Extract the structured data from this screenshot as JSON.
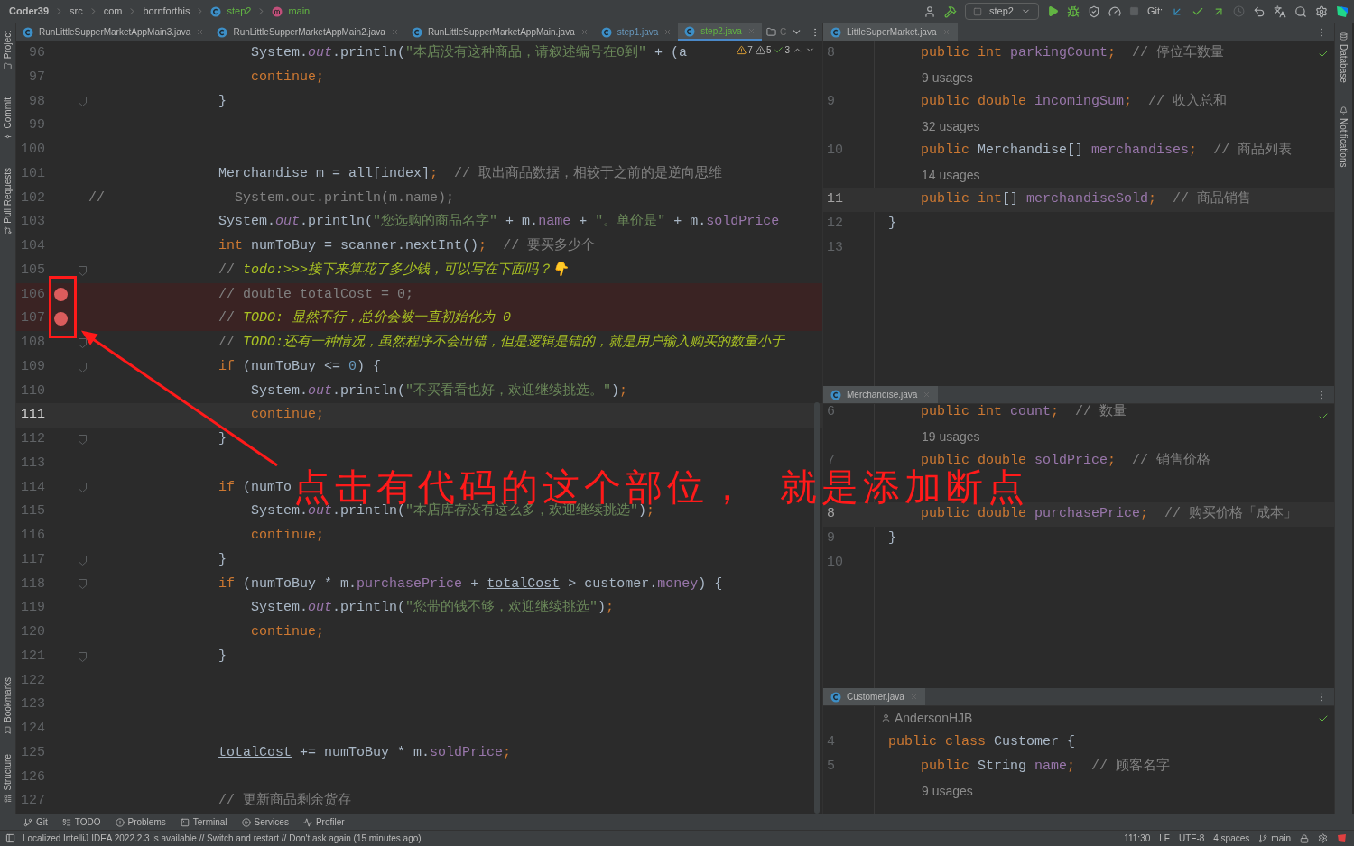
{
  "breadcrumbs": [
    {
      "text": "Coder39",
      "kind": "project"
    },
    {
      "text": "src",
      "kind": "folder"
    },
    {
      "text": "com",
      "kind": "folder"
    },
    {
      "text": "bornforthis",
      "kind": "folder"
    },
    {
      "text": "step2",
      "kind": "class"
    },
    {
      "text": "main",
      "kind": "method"
    }
  ],
  "toolbar": {
    "run_config": "step2",
    "git_label": "Git:"
  },
  "left_tools_top": [
    "Project",
    "Commit",
    "Pull Requests"
  ],
  "left_tools_bottom": [
    "Bookmarks",
    "Structure"
  ],
  "right_tools": [
    "Database",
    "Notifications"
  ],
  "editor": {
    "tabs": [
      {
        "label": "RunLittleSupperMarketAppMain3.java",
        "selected": false,
        "color": "#bbbbbb"
      },
      {
        "label": "RunLittleSupperMarketAppMain2.java",
        "selected": false,
        "color": "#bbbbbb"
      },
      {
        "label": "RunLittleSupperMarketAppMain.java",
        "selected": false,
        "color": "#bbbbbb"
      },
      {
        "label": "step1.java",
        "selected": false,
        "color": "#6897bb"
      },
      {
        "label": "step2.java",
        "selected": true,
        "color": "#62b543"
      }
    ],
    "overflow_tab": "C",
    "inspections": [
      {
        "kind": "error",
        "count": "7"
      },
      {
        "kind": "warning",
        "count": "5"
      },
      {
        "kind": "ok",
        "count": "3"
      }
    ],
    "lines": [
      {
        "number": "96",
        "current": false,
        "breakpoint": false,
        "fold": false,
        "tokens": [
          {
            "kind": "plain",
            "text": "                    System."
          },
          {
            "kind": "static",
            "text": "out"
          },
          {
            "kind": "plain",
            "text": ".println("
          },
          {
            "kind": "string",
            "text": "\"本店没有这种商品，请叙述编号在0到\""
          },
          {
            "kind": "plain",
            "text": " + (a"
          }
        ]
      },
      {
        "number": "97",
        "current": false,
        "breakpoint": false,
        "fold": false,
        "tokens": [
          {
            "kind": "keyword",
            "text": "                    continue;"
          }
        ]
      },
      {
        "number": "98",
        "current": false,
        "breakpoint": false,
        "fold": true,
        "tokens": [
          {
            "kind": "plain",
            "text": "                }"
          }
        ]
      },
      {
        "number": "99",
        "current": false,
        "breakpoint": false,
        "fold": false
      },
      {
        "number": "100",
        "current": false,
        "breakpoint": false,
        "fold": false
      },
      {
        "number": "101",
        "current": false,
        "breakpoint": false,
        "fold": false,
        "tokens": [
          {
            "kind": "plain",
            "text": "                Merchandise m = all[index]"
          },
          {
            "kind": "keyword",
            "text": ";"
          },
          {
            "kind": "comment",
            "text": "  // 取出商品数据，相较于之前的是逆向思维"
          }
        ]
      },
      {
        "number": "102",
        "current": false,
        "breakpoint": false,
        "fold": false,
        "tokens": [
          {
            "kind": "comment",
            "text": "//                System.out.println(m.name);"
          }
        ]
      },
      {
        "number": "103",
        "current": false,
        "breakpoint": false,
        "fold": false,
        "tokens": [
          {
            "kind": "plain",
            "text": "                System."
          },
          {
            "kind": "static",
            "text": "out"
          },
          {
            "kind": "plain",
            "text": ".println("
          },
          {
            "kind": "string",
            "text": "\"您选购的商品名字\""
          },
          {
            "kind": "plain",
            "text": " + m."
          },
          {
            "kind": "field",
            "text": "name"
          },
          {
            "kind": "plain",
            "text": " + "
          },
          {
            "kind": "string",
            "text": "\"。单价是\""
          },
          {
            "kind": "plain",
            "text": " + m."
          },
          {
            "kind": "field",
            "text": "soldPrice"
          }
        ]
      },
      {
        "number": "104",
        "current": false,
        "breakpoint": false,
        "fold": false,
        "tokens": [
          {
            "kind": "keyword",
            "text": "                int"
          },
          {
            "kind": "plain",
            "text": " numToBuy = scanner.nextInt()"
          },
          {
            "kind": "keyword",
            "text": ";"
          },
          {
            "kind": "comment",
            "text": "  // 要买多少个"
          }
        ]
      },
      {
        "number": "105",
        "current": false,
        "breakpoint": false,
        "fold": true,
        "tokens": [
          {
            "kind": "comment",
            "text": "                // "
          },
          {
            "kind": "todo",
            "text": "todo:>>>接下来算花了多少钱，可以写在下面吗？👇"
          }
        ]
      },
      {
        "number": "106",
        "current": false,
        "breakpoint": true,
        "fold": false,
        "tokens": [
          {
            "kind": "comment",
            "text": "                // double totalCost = 0;"
          }
        ]
      },
      {
        "number": "107",
        "current": false,
        "breakpoint": true,
        "fold": false,
        "tokens": [
          {
            "kind": "comment",
            "text": "                // "
          },
          {
            "kind": "todo",
            "text": "TODO: 显然不行，总价会被一直初始化为 0"
          }
        ]
      },
      {
        "number": "108",
        "current": false,
        "breakpoint": false,
        "fold": true,
        "tokens": [
          {
            "kind": "comment",
            "text": "                // "
          },
          {
            "kind": "todo",
            "text": "TODO:还有一种情况，虽然程序不会出错，但是逻辑是错的，就是用户输入购买的数量小于"
          }
        ]
      },
      {
        "number": "109",
        "current": false,
        "breakpoint": false,
        "fold": true,
        "tokens": [
          {
            "kind": "keyword",
            "text": "                if"
          },
          {
            "kind": "plain",
            "text": " (numToBuy <= "
          },
          {
            "kind": "number",
            "text": "0"
          },
          {
            "kind": "plain",
            "text": ") {"
          }
        ]
      },
      {
        "number": "110",
        "current": false,
        "breakpoint": false,
        "fold": false,
        "tokens": [
          {
            "kind": "plain",
            "text": "                    System."
          },
          {
            "kind": "static",
            "text": "out"
          },
          {
            "kind": "plain",
            "text": ".println("
          },
          {
            "kind": "string",
            "text": "\"不买看看也好，欢迎继续挑选。\""
          },
          {
            "kind": "plain",
            "text": ")"
          },
          {
            "kind": "keyword",
            "text": ";"
          }
        ]
      },
      {
        "number": "111",
        "current": true,
        "breakpoint": false,
        "fold": false,
        "tokens": [
          {
            "kind": "keyword",
            "text": "                    continue;"
          }
        ]
      },
      {
        "number": "112",
        "current": false,
        "breakpoint": false,
        "fold": true,
        "tokens": [
          {
            "kind": "plain",
            "text": "                }"
          }
        ]
      },
      {
        "number": "113",
        "current": false,
        "breakpoint": false,
        "fold": false
      },
      {
        "number": "114",
        "current": false,
        "breakpoint": false,
        "fold": true,
        "tokens": [
          {
            "kind": "keyword",
            "text": "                if"
          },
          {
            "kind": "plain",
            "text": " (numTo"
          }
        ]
      },
      {
        "number": "115",
        "current": false,
        "breakpoint": false,
        "fold": false,
        "tokens": [
          {
            "kind": "plain",
            "text": "                    System."
          },
          {
            "kind": "static",
            "text": "out"
          },
          {
            "kind": "plain",
            "text": ".println("
          },
          {
            "kind": "string",
            "text": "\"本店库存没有这么多，欢迎继续挑选\""
          },
          {
            "kind": "plain",
            "text": ")"
          },
          {
            "kind": "keyword",
            "text": ";"
          }
        ]
      },
      {
        "number": "116",
        "current": false,
        "breakpoint": false,
        "fold": false,
        "tokens": [
          {
            "kind": "keyword",
            "text": "                    continue;"
          }
        ]
      },
      {
        "number": "117",
        "current": false,
        "breakpoint": false,
        "fold": true,
        "tokens": [
          {
            "kind": "plain",
            "text": "                }"
          }
        ]
      },
      {
        "number": "118",
        "current": false,
        "breakpoint": false,
        "fold": true,
        "tokens": [
          {
            "kind": "keyword",
            "text": "                if"
          },
          {
            "kind": "plain",
            "text": " (numToBuy * m."
          },
          {
            "kind": "field",
            "text": "purchasePrice"
          },
          {
            "kind": "plain",
            "text": " + "
          },
          {
            "kind": "underlined",
            "text": "totalCost"
          },
          {
            "kind": "plain",
            "text": " > customer."
          },
          {
            "kind": "field",
            "text": "money"
          },
          {
            "kind": "plain",
            "text": ") {"
          }
        ]
      },
      {
        "number": "119",
        "current": false,
        "breakpoint": false,
        "fold": false,
        "tokens": [
          {
            "kind": "plain",
            "text": "                    System."
          },
          {
            "kind": "static",
            "text": "out"
          },
          {
            "kind": "plain",
            "text": ".println("
          },
          {
            "kind": "string",
            "text": "\"您带的钱不够，欢迎继续挑选\""
          },
          {
            "kind": "plain",
            "text": ")"
          },
          {
            "kind": "keyword",
            "text": ";"
          }
        ]
      },
      {
        "number": "120",
        "current": false,
        "breakpoint": false,
        "fold": false,
        "tokens": [
          {
            "kind": "keyword",
            "text": "                    continue;"
          }
        ]
      },
      {
        "number": "121",
        "current": false,
        "breakpoint": false,
        "fold": true,
        "tokens": [
          {
            "kind": "plain",
            "text": "                }"
          }
        ]
      },
      {
        "number": "122",
        "current": false,
        "breakpoint": false,
        "fold": false
      },
      {
        "number": "123",
        "current": false,
        "breakpoint": false,
        "fold": false
      },
      {
        "number": "124",
        "current": false,
        "breakpoint": false,
        "fold": false
      },
      {
        "number": "125",
        "current": false,
        "breakpoint": false,
        "fold": false,
        "tokens": [
          {
            "kind": "underlined",
            "text": "                totalCost"
          },
          {
            "kind": "plain",
            "text": " += numToBuy * m."
          },
          {
            "kind": "field",
            "text": "soldPrice"
          },
          {
            "kind": "keyword",
            "text": ";"
          }
        ]
      },
      {
        "number": "126",
        "current": false,
        "breakpoint": false,
        "fold": false
      },
      {
        "number": "127",
        "current": false,
        "breakpoint": false,
        "fold": false,
        "tokens": [
          {
            "kind": "comment",
            "text": "                // 更新商品剩余货存"
          }
        ]
      }
    ]
  },
  "split_panes": [
    {
      "file": "LittleSuperMarket.java",
      "lines": [
        {
          "kind": "code",
          "number": "8",
          "current": false,
          "tokens": [
            {
              "kind": "keyword",
              "text": "    public int "
            },
            {
              "kind": "field",
              "text": "parkingCount"
            },
            {
              "kind": "keyword",
              "text": ";"
            },
            {
              "kind": "comment",
              "text": "  // 停位车数量"
            }
          ]
        },
        {
          "kind": "hint",
          "text": "9 usages"
        },
        {
          "kind": "code",
          "number": "9",
          "current": false,
          "tokens": [
            {
              "kind": "keyword",
              "text": "    public double "
            },
            {
              "kind": "field",
              "text": "incomingSum"
            },
            {
              "kind": "keyword",
              "text": ";"
            },
            {
              "kind": "comment",
              "text": "  // 收入总和"
            }
          ]
        },
        {
          "kind": "hint",
          "text": "32 usages"
        },
        {
          "kind": "code",
          "number": "10",
          "current": false,
          "tokens": [
            {
              "kind": "keyword",
              "text": "    public "
            },
            {
              "kind": "plain",
              "text": "Merchandise[] "
            },
            {
              "kind": "field",
              "text": "merchandises"
            },
            {
              "kind": "keyword",
              "text": ";"
            },
            {
              "kind": "comment",
              "text": "  // 商品列表"
            }
          ]
        },
        {
          "kind": "hint",
          "text": "14 usages"
        },
        {
          "kind": "code",
          "number": "11",
          "current": true,
          "tokens": [
            {
              "kind": "keyword",
              "text": "    public int"
            },
            {
              "kind": "plain",
              "text": "[] "
            },
            {
              "kind": "field",
              "text": "merchandiseSold"
            },
            {
              "kind": "keyword",
              "text": ";"
            },
            {
              "kind": "comment",
              "text": "  // 商品销售"
            }
          ]
        },
        {
          "kind": "code",
          "number": "12",
          "current": false,
          "tokens": [
            {
              "kind": "plain",
              "text": "}"
            }
          ]
        },
        {
          "kind": "code",
          "number": "13",
          "current": false
        }
      ]
    },
    {
      "file": "Merchandise.java",
      "lines": [
        {
          "kind": "code",
          "number": "6",
          "current": false,
          "tokens": [
            {
              "kind": "keyword",
              "text": "    public int "
            },
            {
              "kind": "field",
              "text": "count"
            },
            {
              "kind": "keyword",
              "text": ";"
            },
            {
              "kind": "comment",
              "text": "  // 数量"
            }
          ]
        },
        {
          "kind": "hint",
          "text": "19 usages"
        },
        {
          "kind": "code",
          "number": "7",
          "current": false,
          "tokens": [
            {
              "kind": "keyword",
              "text": "    public double "
            },
            {
              "kind": "field",
              "text": "soldPrice"
            },
            {
              "kind": "keyword",
              "text": ";"
            },
            {
              "kind": "comment",
              "text": "  // 销售价格"
            }
          ]
        },
        {
          "kind": "blank"
        },
        {
          "kind": "code",
          "number": "8",
          "current": true,
          "tokens": [
            {
              "kind": "keyword",
              "text": "    public double "
            },
            {
              "kind": "field",
              "text": "purchasePrice"
            },
            {
              "kind": "keyword",
              "text": ";"
            },
            {
              "kind": "comment",
              "text": "  // 购买价格「成本」"
            }
          ]
        },
        {
          "kind": "code",
          "number": "9",
          "current": false,
          "tokens": [
            {
              "kind": "plain",
              "text": "}"
            }
          ]
        },
        {
          "kind": "code",
          "number": "10",
          "current": false
        }
      ]
    },
    {
      "file": "Customer.java",
      "lines": [
        {
          "kind": "author",
          "text": "AndersonHJB"
        },
        {
          "kind": "code",
          "number": "4",
          "current": false,
          "tokens": [
            {
              "kind": "keyword",
              "text": "public class "
            },
            {
              "kind": "plain",
              "text": "Customer {"
            }
          ]
        },
        {
          "kind": "code",
          "number": "5",
          "current": false,
          "tokens": [
            {
              "kind": "keyword",
              "text": "    public "
            },
            {
              "kind": "plain",
              "text": "String "
            },
            {
              "kind": "field",
              "text": "name"
            },
            {
              "kind": "keyword",
              "text": ";"
            },
            {
              "kind": "comment",
              "text": "  // 顾客名字"
            }
          ]
        },
        {
          "kind": "hint",
          "text": "9 usages"
        }
      ]
    }
  ],
  "annotation": {
    "text": "点击有代码的这个部位，  就是添加断点"
  },
  "tool_windows": [
    "Git",
    "TODO",
    "Problems",
    "Terminal",
    "Services",
    "Profiler"
  ],
  "status": {
    "message": "Localized IntelliJ IDEA 2022.2.3 is available // Switch and restart // Don't ask again (15 minutes ago)",
    "position": "111:30",
    "line_separator": "LF",
    "encoding": "UTF-8",
    "indent": "4 spaces",
    "branch": "main"
  }
}
